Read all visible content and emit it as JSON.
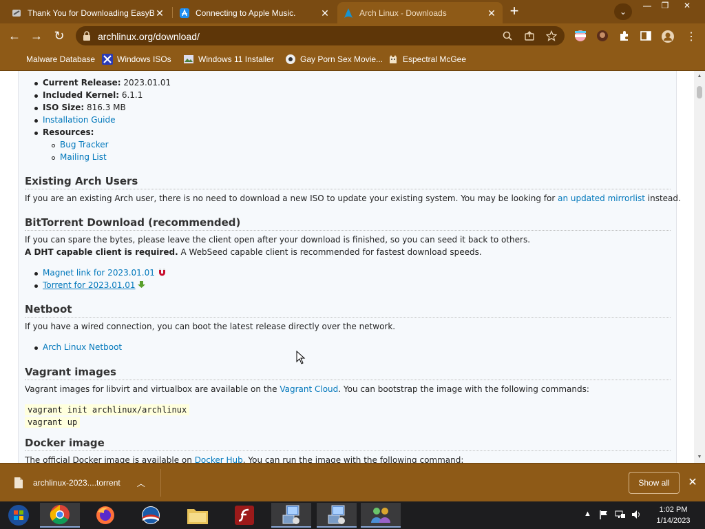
{
  "tabs": [
    {
      "title": "Thank You for Downloading EasyB",
      "close": "✕"
    },
    {
      "title": "Connecting to Apple Music.",
      "close": "✕"
    },
    {
      "title": "Arch Linux - Downloads",
      "close": "✕"
    }
  ],
  "new_tab": "+",
  "tab_search": "⌄",
  "window_controls": {
    "minimize": "—",
    "restore": "❐",
    "close": "✕"
  },
  "nav": {
    "back": "←",
    "forward": "→",
    "reload": "↻"
  },
  "omnibox": {
    "url": "archlinux.org/download/"
  },
  "bookmarks": [
    {
      "label": "Malware Database",
      "icon": "star-icon"
    },
    {
      "label": "Windows ISOs",
      "icon": "x-icon"
    },
    {
      "label": "Windows 11 Installer",
      "icon": "image-icon"
    },
    {
      "label": "Gay Porn Sex Movie...",
      "icon": "site-icon"
    },
    {
      "label": "Espectral McGee",
      "icon": "cat-icon"
    }
  ],
  "page": {
    "info": [
      {
        "label": "Current Release:",
        "value": "2023.01.01"
      },
      {
        "label": "Included Kernel:",
        "value": "6.1.1"
      },
      {
        "label": "ISO Size:",
        "value": "816.3 MB"
      }
    ],
    "install_guide": "Installation Guide",
    "resources_label": "Resources:",
    "resources": [
      "Bug Tracker",
      "Mailing List"
    ],
    "existing": {
      "heading": "Existing Arch Users",
      "text_before": "If you are an existing Arch user, there is no need to download a new ISO to update your existing system. You may be looking for ",
      "link": "an updated mirrorlist",
      "text_after": " instead."
    },
    "bittorrent": {
      "heading": "BitTorrent Download (recommended)",
      "text1": "If you can spare the bytes, please leave the client open after your download is finished, so you can seed it back to others.",
      "bold": "A DHT capable client is required.",
      "text2": " A WebSeed capable client is recommended for fastest download speeds.",
      "magnet": "Magnet link for 2023.01.01",
      "torrent": "Torrent for 2023.01.01"
    },
    "netboot": {
      "heading": "Netboot",
      "text": "If you have a wired connection, you can boot the latest release directly over the network.",
      "link": "Arch Linux Netboot"
    },
    "vagrant": {
      "heading": "Vagrant images",
      "text_before": "Vagrant images for libvirt and virtualbox are available on the ",
      "link": "Vagrant Cloud",
      "text_after": ". You can bootstrap the image with the following commands:",
      "code": [
        "vagrant init archlinux/archlinux",
        "vagrant up"
      ]
    },
    "docker": {
      "heading": "Docker image",
      "text_before": "The official Docker image is available on ",
      "link": "Docker Hub",
      "text_after": ". You can run the image with the following command:"
    }
  },
  "download_bar": {
    "filename": "archlinux-2023....torrent",
    "show_all": "Show all",
    "close": "✕"
  },
  "taskbar": {
    "apps": [
      "start-orb",
      "chrome",
      "firefox",
      "obama-app",
      "file-explorer",
      "flash",
      "network-tool-1",
      "network-tool-2",
      "users-app"
    ],
    "time": "1:02 PM",
    "date": "1/14/2023"
  },
  "colors": {
    "chrome_frame": "#8e5a17",
    "tab_strip": "#7a4b12",
    "link": "#0077bb"
  }
}
